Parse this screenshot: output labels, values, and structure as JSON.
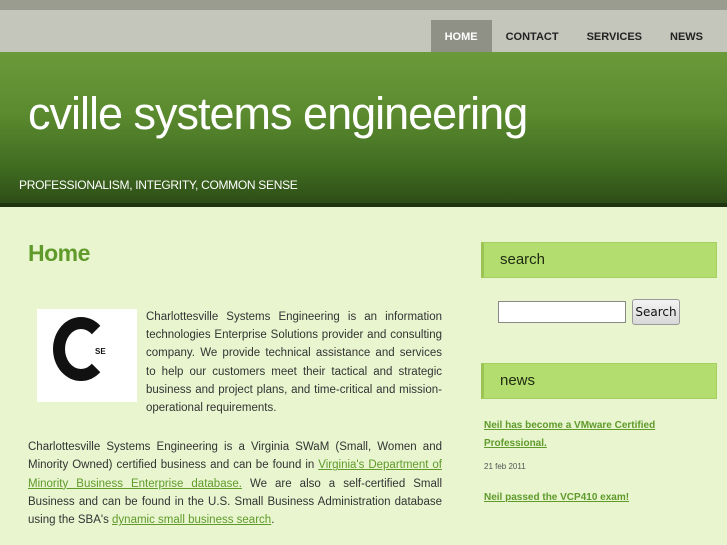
{
  "nav": {
    "items": [
      {
        "label": "HOME",
        "active": true
      },
      {
        "label": "CONTACT",
        "active": false
      },
      {
        "label": "SERVICES",
        "active": false
      },
      {
        "label": "NEWS",
        "active": false
      }
    ]
  },
  "banner": {
    "title": "cville systems engineering",
    "tagline": "PROFESSIONALISM, INTEGRITY, COMMON SENSE"
  },
  "main": {
    "page_title": "Home",
    "logo_text": "SE",
    "intro": "Charlottesville Systems Engineering is an information technologies Enterprise Solutions provider and consulting company. We provide technical assistance and services to help our customers meet their tactical and strategic business and project plans, and time-critical and mission-operational requirements.",
    "para2": {
      "text1": "Charlottesville Systems Engineering is a Virginia SWaM (Small, Women and Minority Owned) certified business and can be found in ",
      "link1": "Virginia's Department of Minority Business Enterprise database.",
      "text2": " We are also a self-certified Small Business and can be found in the U.S. Small Business Administration database using the SBA's ",
      "link2": "dynamic small business search",
      "text3": "."
    }
  },
  "sidebar": {
    "search_heading": "search",
    "search_button": "Search",
    "search_value": "",
    "news_heading": "news",
    "news": [
      {
        "title": "Neil has become a VMware Certified Professional.",
        "date": "21 feb 2011"
      },
      {
        "title": "Neil passed the VCP410 exam!",
        "date": ""
      }
    ]
  },
  "colors": {
    "accent_green": "#5f9a2a",
    "sidebar_header": "#b4dd70",
    "background": "#e8f5cf"
  }
}
